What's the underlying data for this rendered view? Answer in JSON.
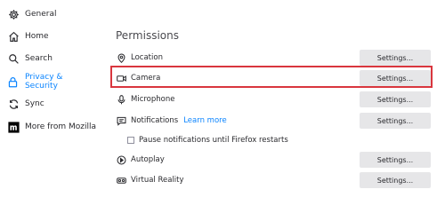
{
  "sidebar": {
    "items": [
      {
        "label": "General",
        "icon": "gear-icon"
      },
      {
        "label": "Home",
        "icon": "home-icon"
      },
      {
        "label": "Search",
        "icon": "search-icon"
      },
      {
        "label": "Privacy & Security",
        "icon": "lock-icon",
        "active": true
      },
      {
        "label": "Sync",
        "icon": "sync-icon"
      },
      {
        "label": "More from Mozilla",
        "icon": "mozilla-icon"
      }
    ]
  },
  "permissions": {
    "title": "Permissions",
    "settings_label": "Settings...",
    "rows": [
      {
        "label": "Location",
        "icon": "location-icon"
      },
      {
        "label": "Camera",
        "icon": "camera-icon",
        "highlighted": true
      },
      {
        "label": "Microphone",
        "icon": "microphone-icon"
      },
      {
        "label": "Notifications",
        "icon": "notification-icon",
        "link": "Learn more"
      },
      {
        "label": "Autoplay",
        "icon": "autoplay-icon"
      },
      {
        "label": "Virtual Reality",
        "icon": "vr-icon"
      }
    ],
    "pause_notifications": {
      "label": "Pause notifications until Firefox restarts",
      "checked": false
    }
  },
  "colors": {
    "accent": "#0a84ff",
    "highlight_border": "#d9363e",
    "button_bg": "#e6e6e8"
  }
}
